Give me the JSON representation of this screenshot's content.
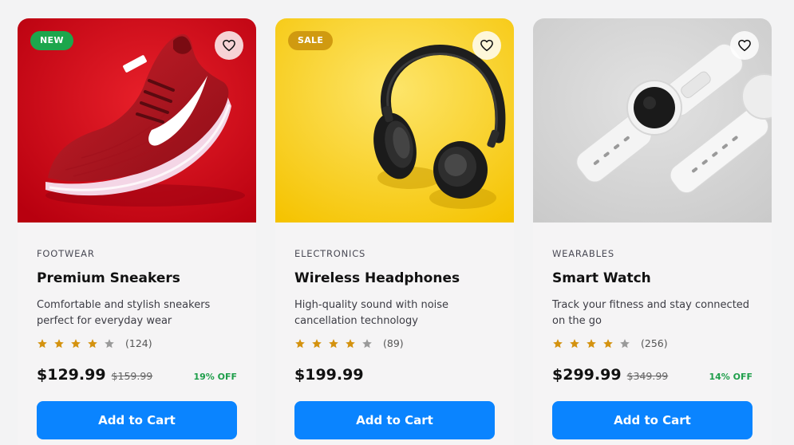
{
  "colors": {
    "accent": "#0a84ff",
    "new_badge": "#1ca64c",
    "sale_badge": "#d09a10",
    "star_filled": "#d4920f",
    "star_empty": "#9a9a9a",
    "discount": "#1e9e4a"
  },
  "products": [
    {
      "badge": "NEW",
      "category": "FOOTWEAR",
      "title": "Premium Sneakers",
      "description": "Comfortable and stylish sneakers perfect for everyday wear",
      "rating": 4,
      "reviews": "(124)",
      "price": "$129.99",
      "old_price": "$159.99",
      "discount": "19% OFF",
      "button_label": "Add to Cart",
      "favorite_icon": "heart-icon"
    },
    {
      "badge": "SALE",
      "category": "ELECTRONICS",
      "title": "Wireless Headphones",
      "description": "High-quality sound with noise cancellation technology",
      "rating": 4,
      "reviews": "(89)",
      "price": "$199.99",
      "button_label": "Add to Cart",
      "favorite_icon": "heart-icon"
    },
    {
      "category": "WEARABLES",
      "title": "Smart Watch",
      "description": "Track your fitness and stay connected on the go",
      "rating": 4,
      "reviews": "(256)",
      "price": "$299.99",
      "old_price": "$349.99",
      "discount": "14% OFF",
      "button_label": "Add to Cart",
      "favorite_icon": "heart-icon"
    }
  ]
}
